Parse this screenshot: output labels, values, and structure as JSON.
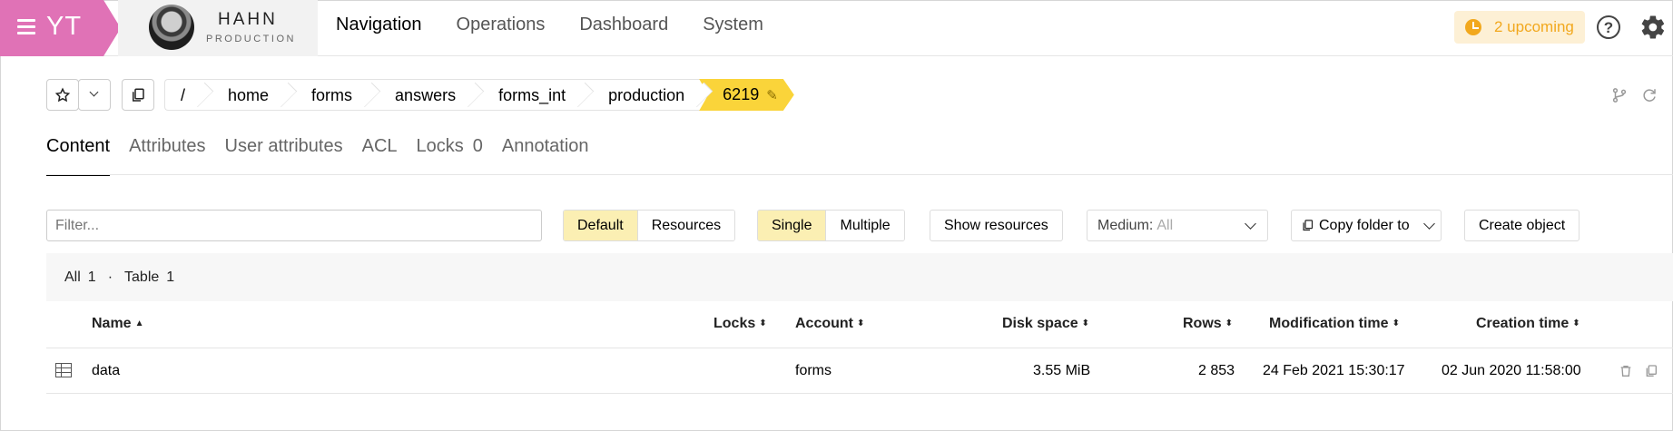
{
  "header": {
    "logo": "YT",
    "cluster": {
      "name": "HAHN",
      "env": "PRODUCTION"
    },
    "nav": [
      "Navigation",
      "Operations",
      "Dashboard",
      "System"
    ],
    "active_nav": "Navigation",
    "upcoming": "2 upcoming"
  },
  "breadcrumbs": [
    "/",
    "home",
    "forms",
    "answers",
    "forms_int",
    "production"
  ],
  "current": "6219",
  "tabs": {
    "content": "Content",
    "attributes": "Attributes",
    "user_attributes": "User attributes",
    "acl": "ACL",
    "locks": "Locks",
    "locks_count": "0",
    "annotation": "Annotation"
  },
  "toolbar": {
    "filter_placeholder": "Filter...",
    "mode": [
      "Default",
      "Resources"
    ],
    "mode_selected": "Default",
    "selection": [
      "Single",
      "Multiple"
    ],
    "selection_selected": "Single",
    "show_resources": "Show resources",
    "medium_label": "Medium:",
    "medium_value": "All",
    "copy_folder": "Copy folder to",
    "create_object": "Create object"
  },
  "summary": {
    "all_label": "All",
    "all_count": "1",
    "table_label": "Table",
    "table_count": "1"
  },
  "table": {
    "columns": [
      "Name",
      "Locks",
      "Account",
      "Disk space",
      "Rows",
      "Modification time",
      "Creation time"
    ],
    "rows": [
      {
        "name": "data",
        "locks": "",
        "account": "forms",
        "disk_space": "3.55 MiB",
        "rows": "2 853",
        "modification_time": "24 Feb 2021 15:30:17",
        "creation_time": "02 Jun 2020 11:58:00"
      }
    ]
  },
  "colors": {
    "logo": "#e072b6",
    "current_crumb": "#fad43a",
    "selected_segment": "#fbefb3",
    "upcoming": "#f2a81d"
  }
}
